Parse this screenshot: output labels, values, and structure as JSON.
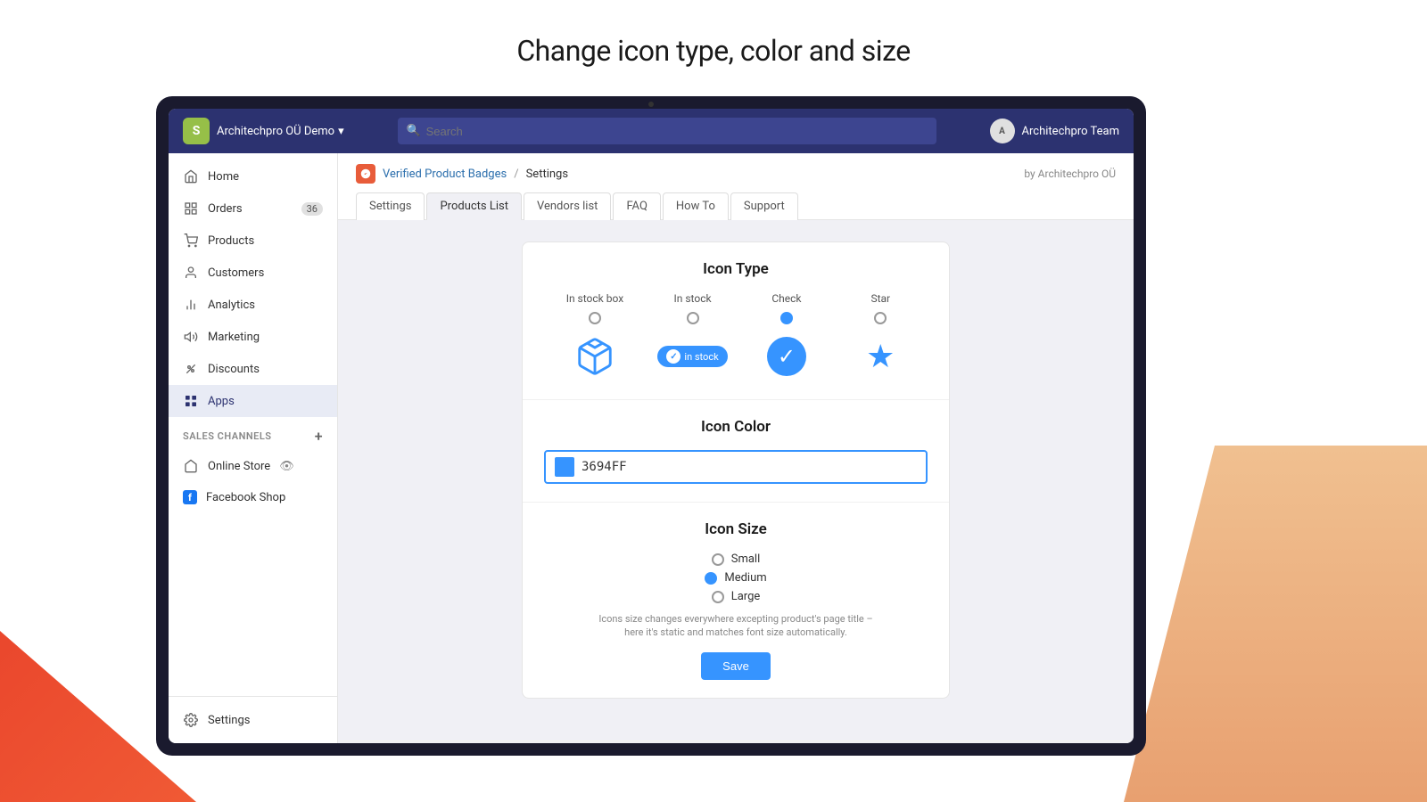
{
  "page": {
    "title": "Change icon type, color and size"
  },
  "nav": {
    "store_name": "Architechpro OÜ Demo",
    "search_placeholder": "Search",
    "user_name": "Architechpro Team",
    "avatar_text": "A"
  },
  "sidebar": {
    "items": [
      {
        "id": "home",
        "label": "Home",
        "icon": "🏠",
        "active": false
      },
      {
        "id": "orders",
        "label": "Orders",
        "icon": "📋",
        "active": false,
        "badge": "36"
      },
      {
        "id": "products",
        "label": "Products",
        "icon": "🏷️",
        "active": false
      },
      {
        "id": "customers",
        "label": "Customers",
        "icon": "👤",
        "active": false
      },
      {
        "id": "analytics",
        "label": "Analytics",
        "icon": "📊",
        "active": false
      },
      {
        "id": "marketing",
        "label": "Marketing",
        "icon": "📢",
        "active": false
      },
      {
        "id": "discounts",
        "label": "Discounts",
        "icon": "🏷",
        "active": false
      },
      {
        "id": "apps",
        "label": "Apps",
        "icon": "⊞",
        "active": true
      }
    ],
    "section_title": "SALES CHANNELS",
    "channels": [
      {
        "id": "online-store",
        "label": "Online Store",
        "icon": "🏪"
      },
      {
        "id": "facebook-shop",
        "label": "Facebook Shop",
        "icon": "f"
      }
    ],
    "bottom": [
      {
        "id": "settings",
        "label": "Settings",
        "icon": "⚙️"
      }
    ]
  },
  "app_header": {
    "app_name": "Verified Product Badges",
    "settings_label": "Settings",
    "by_label": "by Architechpro OÜ"
  },
  "tabs": [
    {
      "id": "settings",
      "label": "Settings",
      "active": false
    },
    {
      "id": "products-list",
      "label": "Products List",
      "active": true
    },
    {
      "id": "vendors-list",
      "label": "Vendors list",
      "active": false
    },
    {
      "id": "faq",
      "label": "FAQ",
      "active": false
    },
    {
      "id": "how-to",
      "label": "How To",
      "active": false
    },
    {
      "id": "support",
      "label": "Support",
      "active": false
    }
  ],
  "card": {
    "icon_type": {
      "title": "Icon Type",
      "options": [
        {
          "id": "in-stock-box",
          "label": "In stock box",
          "selected": false
        },
        {
          "id": "in-stock",
          "label": "In stock",
          "selected": false
        },
        {
          "id": "check",
          "label": "Check",
          "selected": true
        },
        {
          "id": "star",
          "label": "Star",
          "selected": false
        }
      ]
    },
    "icon_color": {
      "title": "Icon Color",
      "value": "3694FF",
      "color_hex": "#3694FF"
    },
    "icon_size": {
      "title": "Icon Size",
      "options": [
        {
          "id": "small",
          "label": "Small",
          "selected": false
        },
        {
          "id": "medium",
          "label": "Medium",
          "selected": true
        },
        {
          "id": "large",
          "label": "Large",
          "selected": false
        }
      ],
      "note": "Icons size changes everywhere excepting product's page title – here it's static and matches font size automatically."
    },
    "save_button_label": "Save"
  }
}
